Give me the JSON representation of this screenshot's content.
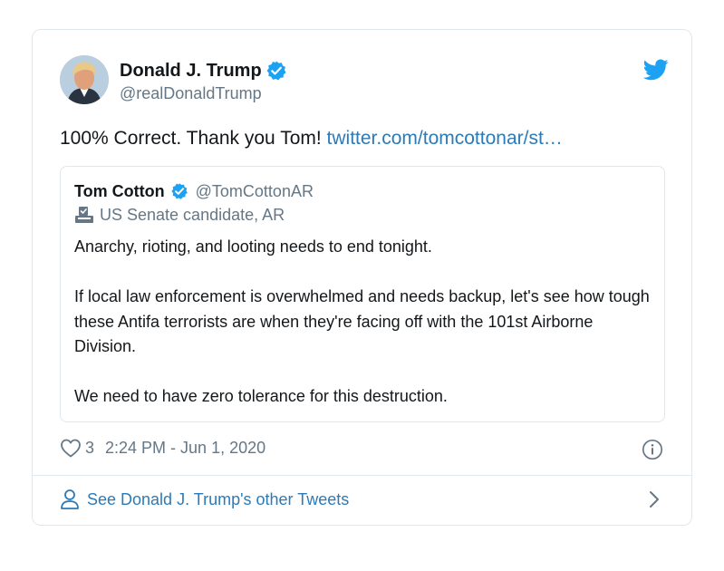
{
  "tweet": {
    "author": {
      "name": "Donald J. Trump",
      "handle": "@realDonaldTrump",
      "verified": true
    },
    "text": "100% Correct. Thank you Tom!",
    "link_text": "twitter.com/tomcottonar/st…",
    "quote": {
      "author": {
        "name": "Tom Cotton",
        "handle": "@TomCottonAR",
        "verified": true
      },
      "label": "US Senate candidate, AR",
      "paragraphs": [
        "Anarchy, rioting, and looting needs to end tonight.",
        "If local law enforcement is overwhelmed and needs backup, let's see how tough these Antifa terrorists are when they're facing off with the 101st Airborne Division.",
        "We need to have zero tolerance for this destruction."
      ]
    },
    "likes": "3",
    "timestamp": "2:24 PM - Jun 1, 2020",
    "footer_link": "See Donald J. Trump's other Tweets"
  },
  "icons": {
    "brand": "twitter-bird-icon",
    "verified": "verified-badge-icon",
    "label": "ballot-box-icon",
    "like": "heart-icon",
    "info": "info-icon",
    "profile": "person-icon",
    "chevron": "chevron-right-icon"
  },
  "colors": {
    "twitter_blue": "#1da1f2",
    "link": "#2b7bb9",
    "secondary_text": "#657786",
    "border": "#e1e8ed"
  }
}
